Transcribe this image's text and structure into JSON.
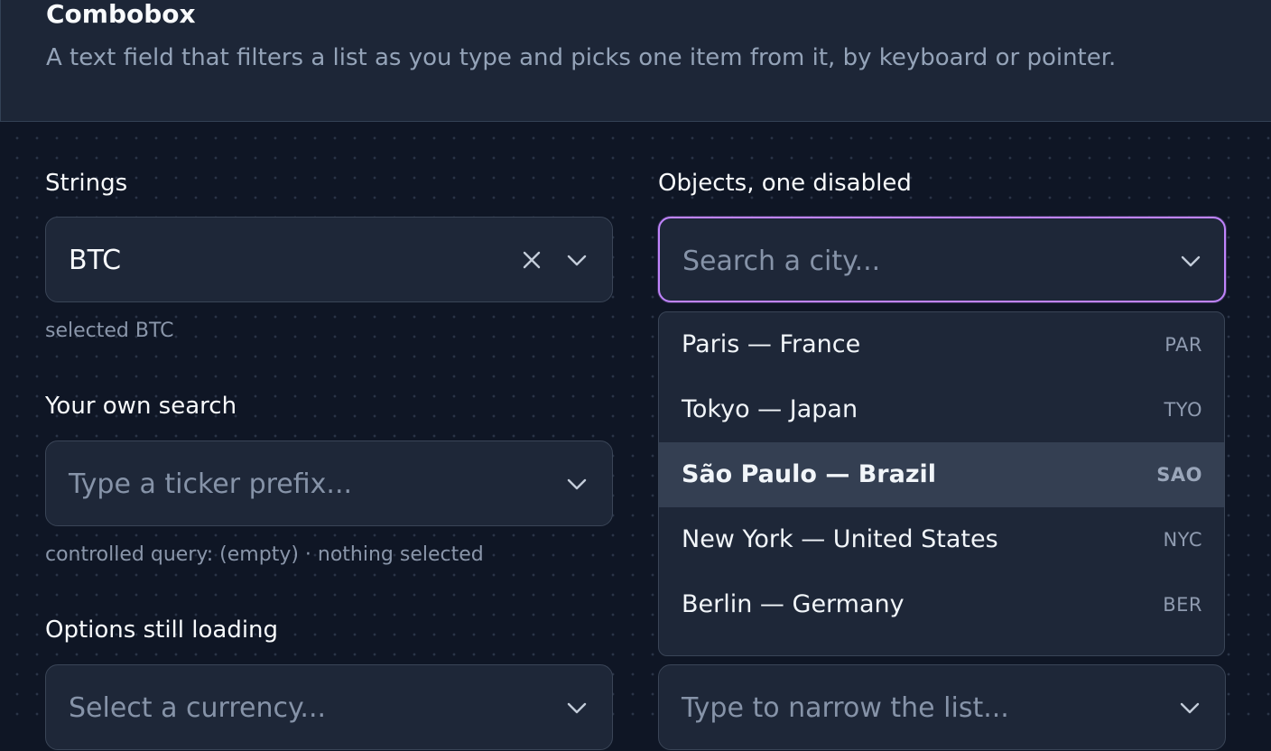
{
  "header": {
    "title": "Combobox",
    "description": "A text field that filters a list as you type and picks one item from it, by keyboard or pointer."
  },
  "strings": {
    "label": "Strings",
    "value": "BTC",
    "helper": "selected BTC"
  },
  "own_search": {
    "label": "Your own search",
    "placeholder": "Type a ticker prefix...",
    "helper": "controlled query: (empty) · nothing selected"
  },
  "loading": {
    "label": "Options still loading",
    "placeholder": "Select a currency..."
  },
  "objects": {
    "label": "Objects, one disabled",
    "placeholder": "Search a city...",
    "options": [
      {
        "label": "Paris — France",
        "code": "PAR",
        "active": false
      },
      {
        "label": "Tokyo — Japan",
        "code": "TYO",
        "active": false
      },
      {
        "label": "São Paulo — Brazil",
        "code": "SAO",
        "active": true
      },
      {
        "label": "New York — United States",
        "code": "NYC",
        "active": false
      },
      {
        "label": "Berlin — Germany",
        "code": "BER",
        "active": false
      }
    ]
  },
  "narrow": {
    "placeholder": "Type to narrow the list..."
  },
  "icons": {
    "clear": "close-icon",
    "toggle": "chevron-down-icon"
  },
  "colors": {
    "background": "#0f1625",
    "surface": "#1e2738",
    "focus_ring": "#c084fc",
    "active_option": "#343f52"
  }
}
